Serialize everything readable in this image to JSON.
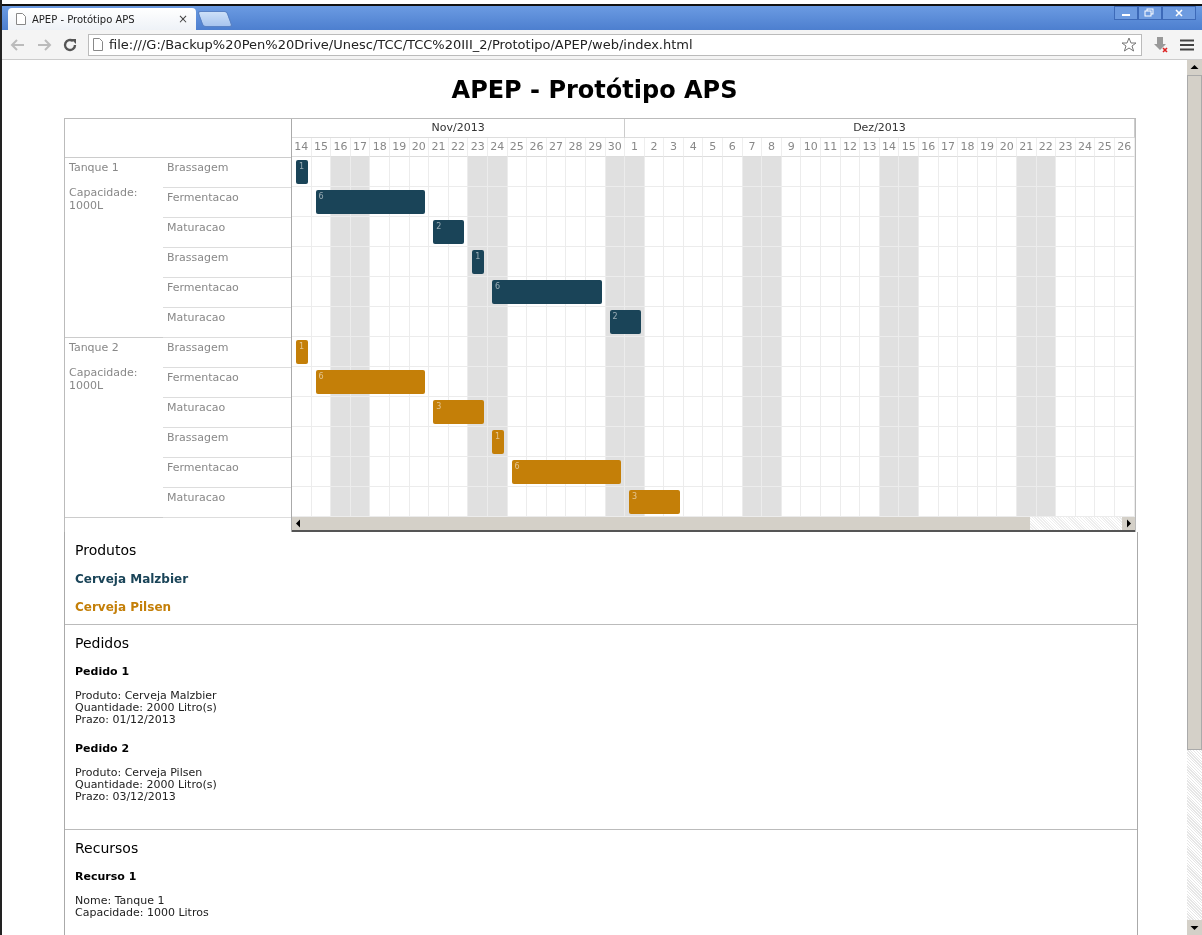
{
  "browser": {
    "tab": {
      "title": "APEP - Protótipo APS",
      "close": "×"
    },
    "address": "file:///G:/Backup%20Pen%20Drive/Unesc/TCC/TCC%20III_2/Prototipo/APEP/web/index.html"
  },
  "page": {
    "title": "APEP - Protótipo APS"
  },
  "gantt": {
    "months": [
      {
        "label": "Nov/2013",
        "days": [
          {
            "label": "14",
            "weekend": false
          },
          {
            "label": "15",
            "weekend": false
          },
          {
            "label": "16",
            "weekend": true
          },
          {
            "label": "17",
            "weekend": true
          },
          {
            "label": "18",
            "weekend": false
          },
          {
            "label": "19",
            "weekend": false
          },
          {
            "label": "20",
            "weekend": false
          },
          {
            "label": "21",
            "weekend": false
          },
          {
            "label": "22",
            "weekend": false
          },
          {
            "label": "23",
            "weekend": true
          },
          {
            "label": "24",
            "weekend": true
          },
          {
            "label": "25",
            "weekend": false
          },
          {
            "label": "26",
            "weekend": false
          },
          {
            "label": "27",
            "weekend": false
          },
          {
            "label": "28",
            "weekend": false
          },
          {
            "label": "29",
            "weekend": false
          },
          {
            "label": "30",
            "weekend": true
          }
        ]
      },
      {
        "label": "Dez/2013",
        "days": [
          {
            "label": "1",
            "weekend": true
          },
          {
            "label": "2",
            "weekend": false
          },
          {
            "label": "3",
            "weekend": false
          },
          {
            "label": "4",
            "weekend": false
          },
          {
            "label": "5",
            "weekend": false
          },
          {
            "label": "6",
            "weekend": false
          },
          {
            "label": "7",
            "weekend": true
          },
          {
            "label": "8",
            "weekend": true
          },
          {
            "label": "9",
            "weekend": false
          },
          {
            "label": "10",
            "weekend": false
          },
          {
            "label": "11",
            "weekend": false
          },
          {
            "label": "12",
            "weekend": false
          },
          {
            "label": "13",
            "weekend": false
          },
          {
            "label": "14",
            "weekend": true
          },
          {
            "label": "15",
            "weekend": true
          },
          {
            "label": "16",
            "weekend": false
          },
          {
            "label": "17",
            "weekend": false
          },
          {
            "label": "18",
            "weekend": false
          },
          {
            "label": "19",
            "weekend": false
          },
          {
            "label": "20",
            "weekend": false
          },
          {
            "label": "21",
            "weekend": true
          },
          {
            "label": "22",
            "weekend": true
          },
          {
            "label": "23",
            "weekend": false
          },
          {
            "label": "24",
            "weekend": false
          },
          {
            "label": "25",
            "weekend": false
          },
          {
            "label": "26",
            "weekend": false
          }
        ]
      }
    ],
    "resources": [
      {
        "name": "Tanque 1",
        "capacity": "Capacidade: 1000L",
        "color": "#1a4458",
        "tasks": [
          {
            "label": "Brassagem",
            "bar": {
              "text": "1"
            }
          },
          {
            "label": "Fermentacao",
            "bar": {
              "text": "6"
            }
          },
          {
            "label": "Maturacao",
            "bar": {
              "text": "2"
            }
          },
          {
            "label": "Brassagem",
            "bar": {
              "text": "1"
            }
          },
          {
            "label": "Fermentacao",
            "bar": {
              "text": "6"
            }
          },
          {
            "label": "Maturacao",
            "bar": {
              "text": "2"
            }
          }
        ]
      },
      {
        "name": "Tanque 2",
        "capacity": "Capacidade: 1000L",
        "color": "#c47f08",
        "tasks": [
          {
            "label": "Brassagem",
            "bar": {
              "text": "1"
            }
          },
          {
            "label": "Fermentacao",
            "bar": {
              "text": "6"
            }
          },
          {
            "label": "Maturacao",
            "bar": {
              "text": "3"
            }
          },
          {
            "label": "Brassagem",
            "bar": {
              "text": "1"
            }
          },
          {
            "label": "Fermentacao",
            "bar": {
              "text": "6"
            }
          },
          {
            "label": "Maturacao",
            "bar": {
              "text": "3"
            }
          }
        ]
      }
    ]
  },
  "produtos": {
    "title": "Produtos",
    "items": [
      {
        "name": "Cerveja Malzbier",
        "color": "#1a4458"
      },
      {
        "name": "Cerveja Pilsen",
        "color": "#c47f08"
      }
    ]
  },
  "pedidos": {
    "title": "Pedidos",
    "items": [
      {
        "title": "Pedido 1",
        "lines": [
          "Produto: Cerveja Malzbier",
          "Quantidade: 2000 Litro(s)",
          "Prazo: 01/12/2013"
        ]
      },
      {
        "title": "Pedido 2",
        "lines": [
          "Produto: Cerveja Pilsen",
          "Quantidade: 2000 Litro(s)",
          "Prazo: 03/12/2013"
        ]
      }
    ]
  },
  "recursos": {
    "title": "Recursos",
    "items": [
      {
        "title": "Recurso 1",
        "lines": [
          "Nome: Tanque 1",
          "Capacidade: 1000 Litros"
        ]
      }
    ]
  }
}
